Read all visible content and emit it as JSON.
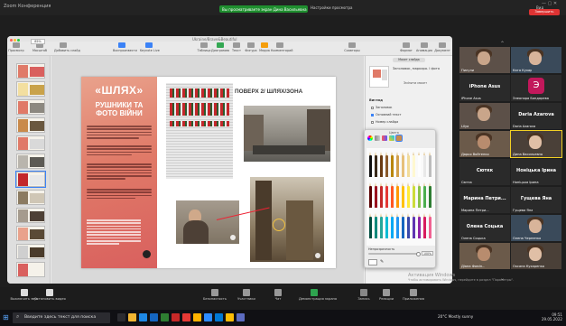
{
  "zoom": {
    "window_title": "Zoom Конференция",
    "share_banner": "Вы просматриваете экран Дина Васильевна",
    "share_settings": "Настройки просмотра",
    "view": "Вид",
    "controls": "— ▢ ✕"
  },
  "keynote": {
    "filename": "Ukraine/Brave&Beautiful",
    "zoom_value": "85%",
    "toolbar": [
      {
        "label": "Просмотр",
        "icon": "view-icon"
      },
      {
        "label": "Масштаб",
        "icon": "zoom-icon"
      },
      {
        "label": "Добавить слайд",
        "icon": "add-slide-icon"
      },
      {
        "label": "Воспроизвести",
        "icon": "play-icon"
      },
      {
        "label": "Keynote Live",
        "icon": "live-icon"
      },
      {
        "label": "Таблица",
        "icon": "table-icon"
      },
      {
        "label": "Диаграмма",
        "icon": "chart-icon"
      },
      {
        "label": "Текст",
        "icon": "text-icon"
      },
      {
        "label": "Фигура",
        "icon": "shape-icon"
      },
      {
        "label": "Медиа",
        "icon": "media-icon"
      },
      {
        "label": "Комментарий",
        "icon": "comment-icon"
      },
      {
        "label": "Соавторы",
        "icon": "collab-icon"
      },
      {
        "label": "Формат",
        "icon": "format-icon"
      },
      {
        "label": "Анимация",
        "icon": "animate-icon"
      },
      {
        "label": "Документ",
        "icon": "document-icon"
      }
    ],
    "slide": {
      "title": "«ШЛЯХ»",
      "subtitle": "РУШНИКИ ТА\nФОТО ВІЙНИ",
      "right_title": "ПОВЕРХ 2/ ШЛЯХ/ЗОНА"
    },
    "inspector": {
      "tab": "Макет слайда",
      "layout_name": "Заголовок, маркиро. і фото",
      "edit_layout": "Змінити макет",
      "section": "Вигляд",
      "checks": [
        {
          "label": "Заголовок",
          "on": false
        },
        {
          "label": "Основний текст",
          "on": true
        },
        {
          "label": "Номер слайда",
          "on": false
        }
      ]
    },
    "colors": {
      "title": "Цвета",
      "opacity_label": "Непрозрачность",
      "opacity_value": "100%"
    }
  },
  "participants": [
    {
      "name": "Пилули",
      "type": "video"
    },
    {
      "name": "Катя Кухар",
      "type": "video"
    },
    {
      "name": "iPhone Asus",
      "type": "name"
    },
    {
      "name": "Элеонора Бондарева",
      "type": "avatar",
      "letter": "Э"
    },
    {
      "name": "Lilya",
      "type": "video"
    },
    {
      "name": "Daria Azarova",
      "type": "name"
    },
    {
      "name": "Дарья Войтенко",
      "type": "video"
    },
    {
      "name": "Дина Васильевна",
      "type": "video",
      "active": true
    },
    {
      "name": "Сюткк",
      "type": "name"
    },
    {
      "name": "Ноніцька Ірина",
      "type": "name"
    },
    {
      "name": "Марина Петри...",
      "type": "name"
    },
    {
      "name": "Гущева Яна",
      "type": "name"
    },
    {
      "name": "Олена Соцька",
      "type": "name"
    },
    {
      "name": "Олена Черненко",
      "type": "video"
    },
    {
      "name": "Діана Фомін...",
      "type": "video"
    },
    {
      "name": "Оксана Кухаренко",
      "type": "video"
    }
  ],
  "bottom_bar": [
    {
      "label": "Выключить звук",
      "icon": "mic-icon"
    },
    {
      "label": "Остановить видео",
      "icon": "camera-icon"
    },
    {
      "label": "Безопасность",
      "icon": "shield-icon"
    },
    {
      "label": "Участники",
      "icon": "participants-icon"
    },
    {
      "label": "Чат",
      "icon": "chat-icon"
    },
    {
      "label": "Демонстрация экрана",
      "icon": "share-icon"
    },
    {
      "label": "Запись",
      "icon": "record-icon"
    },
    {
      "label": "Реакции",
      "icon": "reactions-icon"
    },
    {
      "label": "Приложения",
      "icon": "apps-icon"
    }
  ],
  "recording": "Завершить",
  "activate_windows": {
    "line1": "Активация Windows",
    "line2": "Чтобы активировать Windows, перейдите в раздел \"Параметры\"."
  },
  "taskbar": {
    "search_placeholder": "Введите здесь текст для поиска",
    "weather": "20°C Mostly sunny",
    "time": "09:51",
    "date": "29.05.2022"
  },
  "colors_palette": {
    "accent": "#3b82f6",
    "slide_red": "#d9605e",
    "recording_red": "#dd3333"
  }
}
